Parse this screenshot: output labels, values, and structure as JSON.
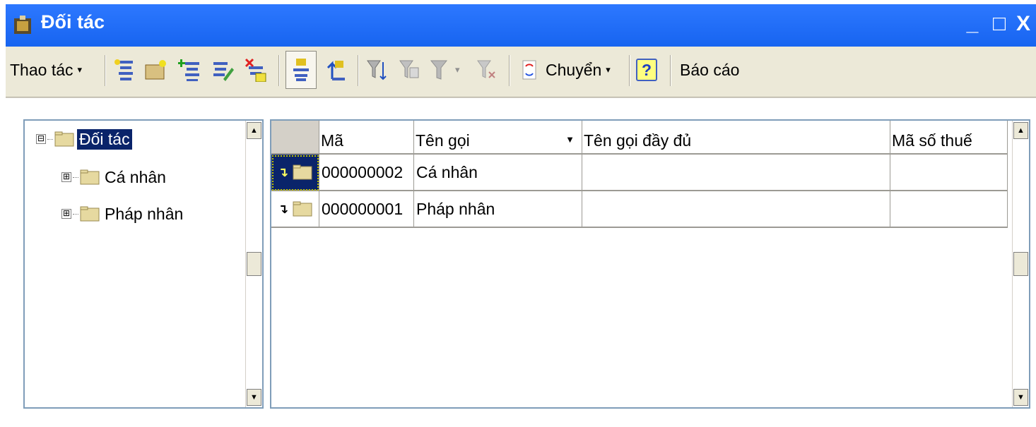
{
  "window": {
    "title": "Đối tác",
    "controls": {
      "minimize": "_",
      "maximize": "□",
      "close": "X"
    }
  },
  "toolbar": {
    "actions_label": "Thao tác",
    "move_label": "Chuyển",
    "help_label": "?",
    "report_label": "Báo cáo",
    "caret": "▾"
  },
  "tree": {
    "expander_collapse": "⊟",
    "expander_expand": "⊞",
    "root": "Đối tác",
    "children": [
      "Cá nhân",
      "Pháp nhân"
    ]
  },
  "grid": {
    "columns": [
      "",
      "Mã",
      "Tên gọi",
      "Tên gọi đầy đủ",
      "Mã số thuế"
    ],
    "sort_marker": "▼",
    "rows": [
      {
        "code": "000000002",
        "name": "Cá nhân",
        "full_name": "",
        "tax_code": "",
        "selected": true
      },
      {
        "code": "000000001",
        "name": "Pháp nhân",
        "full_name": "",
        "tax_code": "",
        "selected": false
      }
    ]
  },
  "scroll": {
    "up": "▲",
    "down": "▼"
  },
  "colors": {
    "title_bar": "#1764f0",
    "selection": "#0a246a",
    "toolbar_bg": "#ece9d8",
    "panel_border": "#7f9db9"
  }
}
